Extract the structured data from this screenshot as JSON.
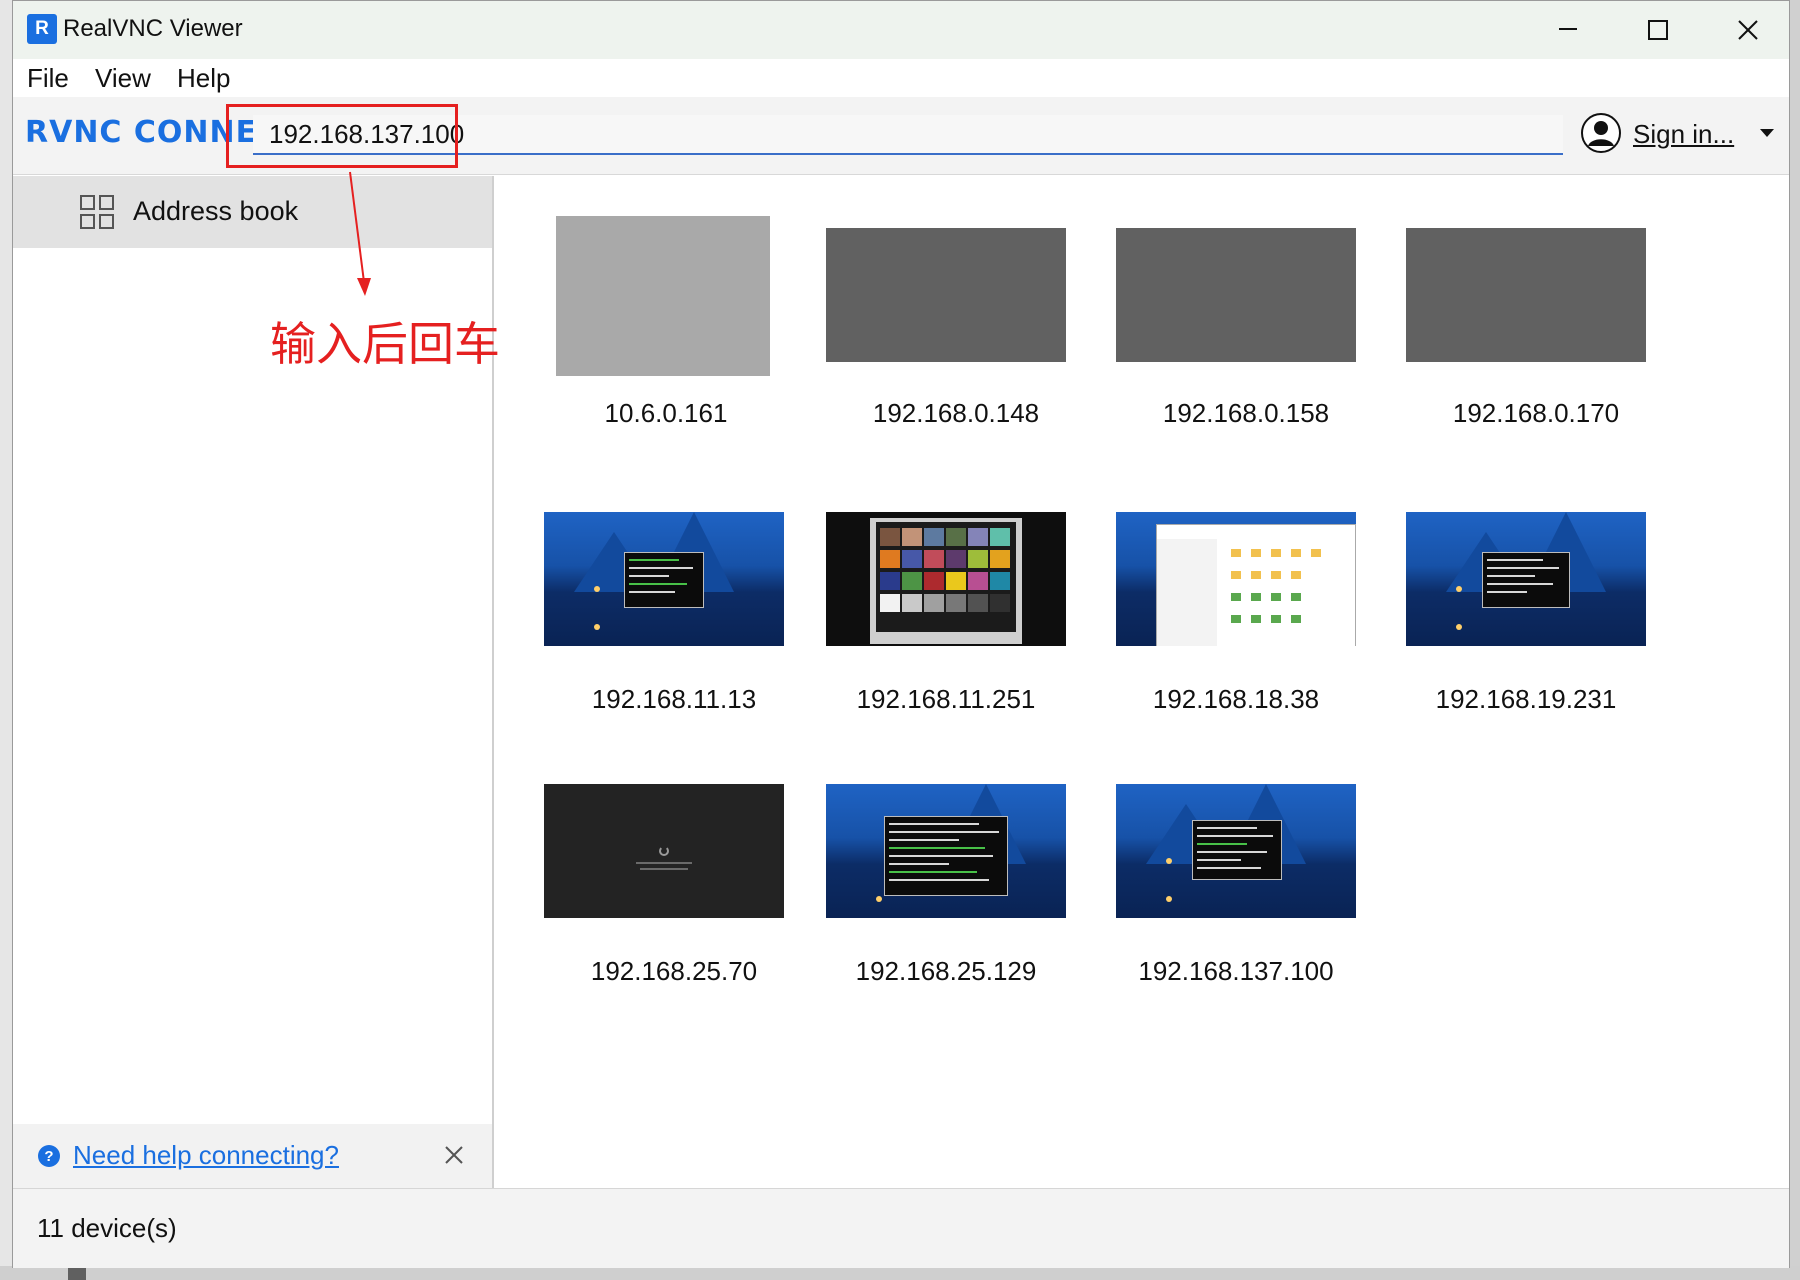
{
  "window": {
    "title": "RealVNC Viewer",
    "app_icon": "realvnc-app-icon",
    "app_icon_text": "R"
  },
  "menu": {
    "items": [
      "File",
      "View",
      "Help"
    ]
  },
  "toolbar": {
    "brand": "RVNC CONNECT",
    "address_value": "192.168.137.100",
    "sign_in_label": "Sign in..."
  },
  "sidebar": {
    "address_book_label": "Address book",
    "help_link_label": "Need help connecting?"
  },
  "annotation": {
    "text": "输入后回车",
    "color": "#e52020"
  },
  "devices": [
    {
      "label": "10.6.0.161",
      "thumbnail": "gray-light"
    },
    {
      "label": "192.168.0.148",
      "thumbnail": "gray-dark"
    },
    {
      "label": "192.168.0.158",
      "thumbnail": "gray-dark"
    },
    {
      "label": "192.168.0.170",
      "thumbnail": "gray-dark"
    },
    {
      "label": "192.168.11.13",
      "thumbnail": "lake-terminal"
    },
    {
      "label": "192.168.11.251",
      "thumbnail": "color-checker"
    },
    {
      "label": "192.168.18.38",
      "thumbnail": "file-manager"
    },
    {
      "label": "192.168.19.231",
      "thumbnail": "lake-terminal"
    },
    {
      "label": "192.168.25.70",
      "thumbnail": "black-loading"
    },
    {
      "label": "192.168.25.129",
      "thumbnail": "lake-terminal"
    },
    {
      "label": "192.168.137.100",
      "thumbnail": "lake-terminal"
    }
  ],
  "status": {
    "device_count": "11 device(s)"
  },
  "colors": {
    "accent": "#1a6fe0",
    "annotation_red": "#e52020"
  }
}
